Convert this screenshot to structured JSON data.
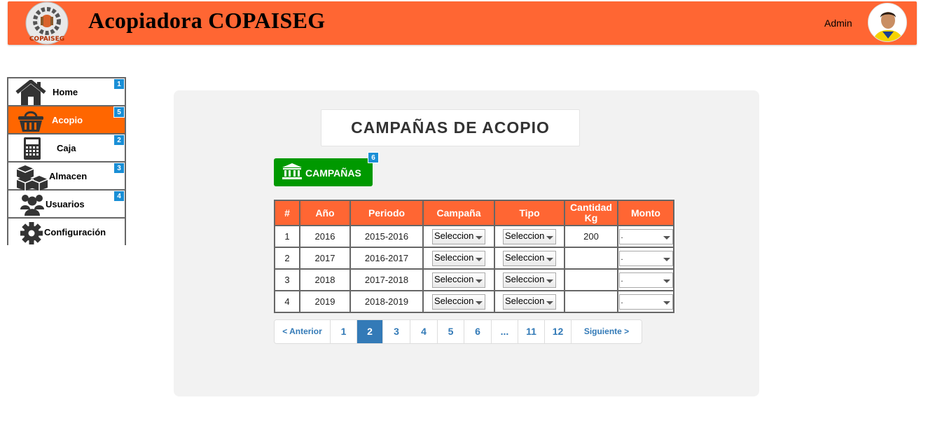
{
  "header": {
    "title": "Acopiadora COPAISEG",
    "logo_text": "COPAISEG",
    "user_label": "Admin"
  },
  "sidebar": {
    "items": [
      {
        "label": "Home",
        "icon": "home-icon",
        "badge": "1",
        "active": false
      },
      {
        "label": "Acopio",
        "icon": "basket-icon",
        "badge": "5",
        "active": true
      },
      {
        "label": "Caja",
        "icon": "calculator-icon",
        "badge": "2",
        "active": false
      },
      {
        "label": "Almacen",
        "icon": "boxes-icon",
        "badge": "3",
        "active": false
      },
      {
        "label": "Usuarios",
        "icon": "users-icon",
        "badge": "4",
        "active": false
      },
      {
        "label": "Configuración",
        "icon": "gear-icon",
        "badge": "",
        "active": false
      }
    ]
  },
  "main": {
    "page_title": "CAMPAÑAS DE ACOPIO",
    "campaigns_button": {
      "label": "CAMPAÑAS",
      "icon": "bank-icon",
      "badge": "6"
    },
    "table": {
      "headers": [
        "#",
        "Año",
        "Periodo",
        "Campaña",
        "Tipo",
        "Cantidad Kg",
        "Monto"
      ],
      "rows": [
        {
          "n": "1",
          "year": "2016",
          "period": "2015-2016",
          "campaign": "Seleccion",
          "type": "Seleccion",
          "qty": "200",
          "amount": "."
        },
        {
          "n": "2",
          "year": "2017",
          "period": "2016-2017",
          "campaign": "Seleccion",
          "type": "Seleccion",
          "qty": "",
          "amount": "."
        },
        {
          "n": "3",
          "year": "2018",
          "period": "2017-2018",
          "campaign": "Seleccion",
          "type": "Seleccion",
          "qty": "",
          "amount": "."
        },
        {
          "n": "4",
          "year": "2019",
          "period": "2018-2019",
          "campaign": "Seleccion",
          "type": "Seleccion",
          "qty": "",
          "amount": "."
        }
      ]
    },
    "pagination": {
      "prev": "< Anterior",
      "pages": [
        "1",
        "2",
        "3",
        "4",
        "5",
        "6",
        "...",
        "11",
        "12"
      ],
      "active": "2",
      "next": "Siguiente >"
    }
  },
  "colors": {
    "header": "#ff6633",
    "active_nav": "#ff6600",
    "badge": "#1a8fd6",
    "button": "#009900",
    "pagination_active": "#337ab7"
  }
}
